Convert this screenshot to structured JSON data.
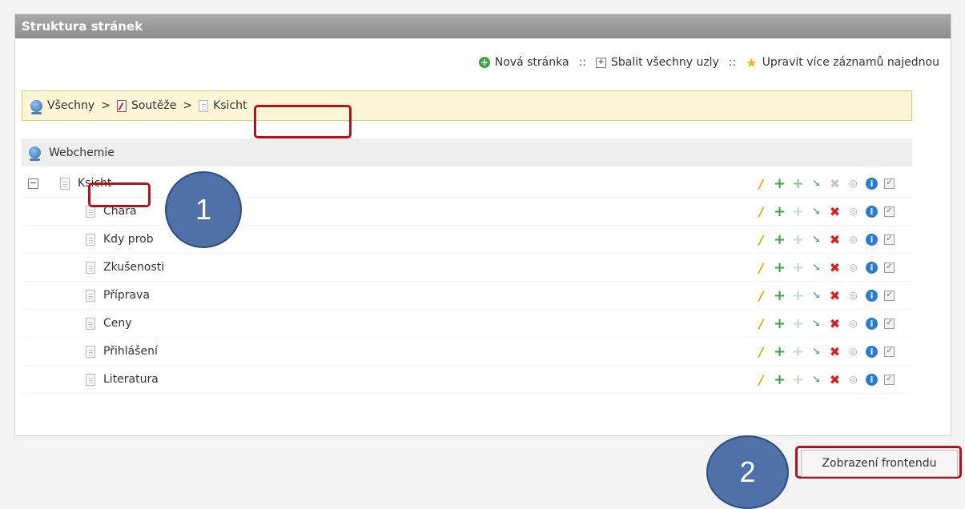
{
  "panel": {
    "title": "Struktura stránek"
  },
  "toolbar": {
    "new_page": "Nová stránka",
    "collapse_all": "Sbalit všechny uzly",
    "edit_multiple": "Upravit více záznamů najednou",
    "separator": "::"
  },
  "breadcrumb": {
    "items": [
      "Všechny",
      "Soutěže",
      "Ksicht"
    ],
    "separator": ">"
  },
  "tree": {
    "root": "Webchemie",
    "parent": "Ksicht",
    "children": [
      "Chara",
      "Kdy prob",
      "Zkušenosti",
      "Příprava",
      "Ceny",
      "Přihlášení",
      "Literatura"
    ]
  },
  "footer": {
    "frontend_button": "Zobrazení frontendu"
  },
  "callouts": [
    "1",
    "2"
  ],
  "colors": {
    "header": "#999999",
    "highlight": "#b3121b",
    "callout": "#4f71a8",
    "breadcrumb_bg": "#fcf6d6"
  }
}
